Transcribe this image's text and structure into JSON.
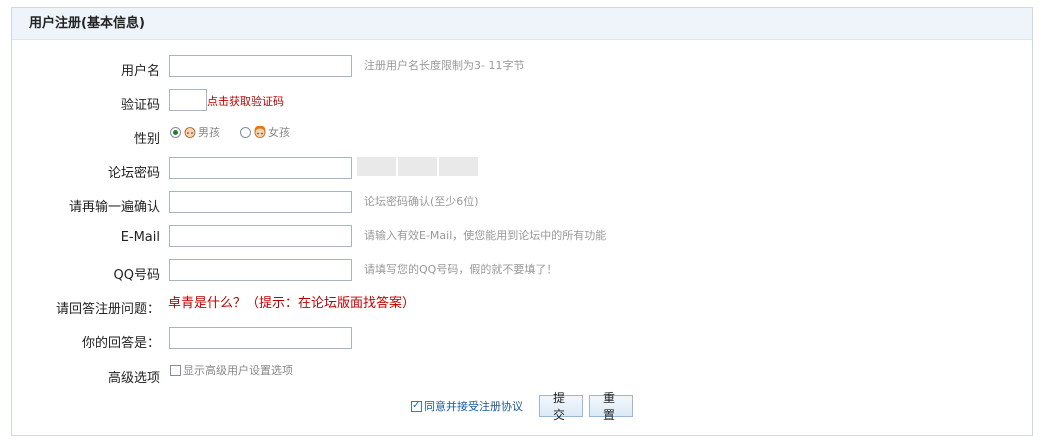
{
  "panel": {
    "title": "用户注册(基本信息)"
  },
  "form": {
    "username": {
      "label": "用户名",
      "value": "",
      "hint": "注册用户名长度限制为3- 11字节"
    },
    "captcha": {
      "label": "验证码",
      "value": "",
      "link": "点击获取验证码"
    },
    "gender": {
      "label": "性别",
      "male": "男孩",
      "female": "女孩",
      "selected": "male"
    },
    "password": {
      "label": "论坛密码",
      "value": ""
    },
    "password_confirm": {
      "label": "请再输一遍确认",
      "value": "",
      "hint": "论坛密码确认(至少6位)"
    },
    "email": {
      "label": "E-Mail",
      "value": "",
      "hint": "请输入有效E-Mail，使您能用到论坛中的所有功能"
    },
    "qq": {
      "label": "QQ号码",
      "value": "",
      "hint": "请填写您的QQ号码，假的就不要填了！"
    },
    "security_question": {
      "label": "请回答注册问题：",
      "question": "卓青是什么？（提示：在论坛版面找答案）"
    },
    "answer": {
      "label": "你的回答是：",
      "value": ""
    },
    "advanced": {
      "label": "高级选项",
      "checkbox_label": "显示高级用户设置选项",
      "checked": false
    }
  },
  "footer": {
    "agree_label": "同意并接受注册协议",
    "agree_checked": true,
    "submit_label": "提交",
    "reset_label": "重置"
  },
  "colors": {
    "header_bg": "#eef4fa",
    "border": "#cfd9e3",
    "question_red": "#c00000",
    "hint_gray": "#999999"
  }
}
